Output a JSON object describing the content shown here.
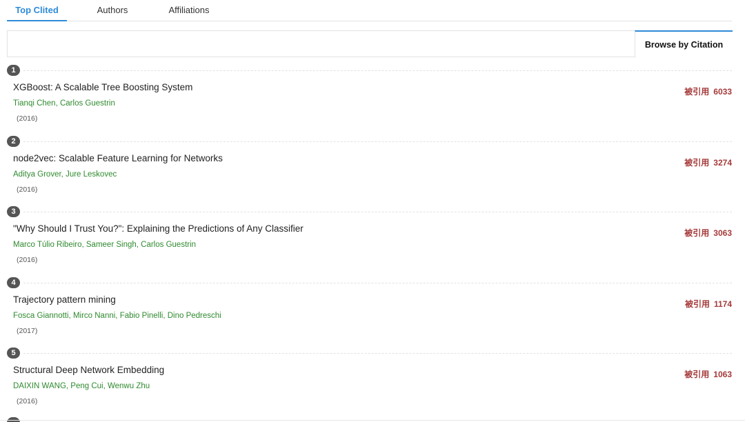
{
  "tabs": [
    {
      "label": "Top Clited",
      "active": true
    },
    {
      "label": "Authors",
      "active": false
    },
    {
      "label": "Affiliations",
      "active": false
    }
  ],
  "filter": {
    "input_value": "",
    "browse_label": "Browse by Citation"
  },
  "citation_label": "被引用",
  "papers": [
    {
      "rank": "1",
      "title": "XGBoost: A Scalable Tree Boosting System",
      "authors": [
        "Tianqi Chen",
        "Carlos Guestrin"
      ],
      "year": "(2016)",
      "citations": "6033"
    },
    {
      "rank": "2",
      "title": "node2vec: Scalable Feature Learning for Networks",
      "authors": [
        "Aditya Grover",
        "Jure Leskovec"
      ],
      "year": "(2016)",
      "citations": "3274"
    },
    {
      "rank": "3",
      "title": "\"Why Should I Trust You?\": Explaining the Predictions of Any Classifier",
      "authors": [
        "Marco Túlio Ribeiro",
        "Sameer Singh",
        "Carlos Guestrin"
      ],
      "year": "(2016)",
      "citations": "3063"
    },
    {
      "rank": "4",
      "title": "Trajectory pattern mining",
      "authors": [
        "Fosca Giannotti",
        "Mirco Nanni",
        "Fabio Pinelli",
        "Dino Pedreschi"
      ],
      "year": "(2017)",
      "citations": "1174"
    },
    {
      "rank": "5",
      "title": "Structural Deep Network Embedding",
      "authors": [
        "DAIXIN WANG",
        "Peng Cui",
        "Wenwu Zhu"
      ],
      "year": "(2016)",
      "citations": "1063"
    }
  ],
  "colors": {
    "accent": "#2e8bd8",
    "author": "#2f8a2f",
    "citation": "#a53a3a",
    "rank_badge": "#555555"
  }
}
